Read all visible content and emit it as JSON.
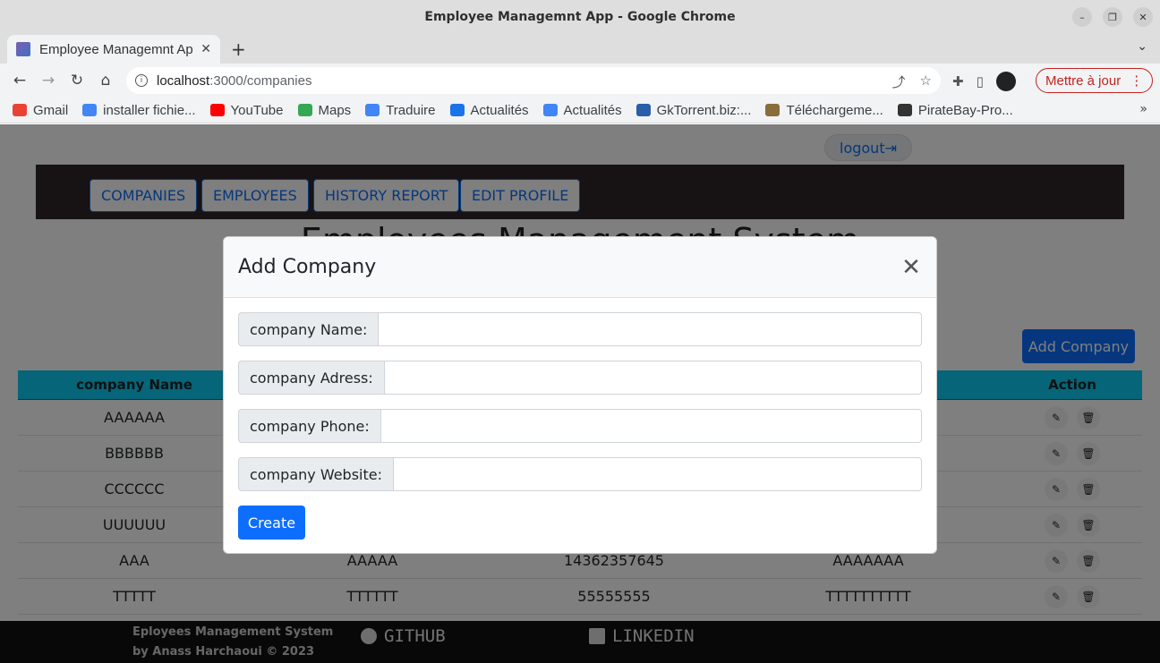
{
  "window": {
    "title": "Employee Managemnt App - Google Chrome"
  },
  "tab": {
    "title": "Employee Managemnt App",
    "close": "✕",
    "new_tab": "+",
    "menu": "⌄"
  },
  "toolbar": {
    "back": "←",
    "forward": "→",
    "reload": "↻",
    "home": "⌂",
    "url_host": "localhost",
    "url_rest": ":3000/companies",
    "share": "⤴",
    "star": "☆",
    "extensions": "✚",
    "sidepanel": "▯",
    "update_label": "Mettre à jour",
    "update_menu": "⋮"
  },
  "bookmarks": {
    "items": [
      {
        "label": "Gmail",
        "color": "#ea4335"
      },
      {
        "label": "installer fichie...",
        "color": "#4285f4"
      },
      {
        "label": "YouTube",
        "color": "#ff0000"
      },
      {
        "label": "Maps",
        "color": "#34a853"
      },
      {
        "label": "Traduire",
        "color": "#4285f4"
      },
      {
        "label": "Actualités",
        "color": "#1a73e8"
      },
      {
        "label": "Actualités",
        "color": "#4285f4"
      },
      {
        "label": "GkTorrent.biz:...",
        "color": "#2a5ea8"
      },
      {
        "label": "Téléchargeme...",
        "color": "#8a6d3b"
      },
      {
        "label": "PirateBay-Pro...",
        "color": "#333333"
      }
    ],
    "more": "»"
  },
  "page": {
    "logout_label": "logout",
    "logout_icon": "⇥",
    "nav": [
      "COMPANIES",
      "EMPLOYEES",
      "HISTORY REPORT",
      "EDIT PROFILE"
    ],
    "title": "Employees Management System",
    "add_company_label": "Add Company",
    "table": {
      "headers": [
        "company Name",
        "",
        "",
        "",
        "Action"
      ],
      "rows": [
        [
          "AAAAAA",
          "",
          "",
          ""
        ],
        [
          "BBBBBB",
          "",
          "",
          ""
        ],
        [
          "CCCCCC",
          "",
          "",
          ""
        ],
        [
          "UUUUUU",
          "",
          "",
          ""
        ],
        [
          "AAA",
          "AAAAA",
          "14362357645",
          "AAAAAAA"
        ],
        [
          "TTTTT",
          "TTTTTT",
          "55555555",
          "TTTTTTTTTT"
        ]
      ],
      "edit_icon": "✎",
      "delete_icon": "🗑"
    },
    "footer": {
      "credit_line1": "Eployees Management System",
      "credit_line2": "by Anass Harchaoui © 2023",
      "github": "GITHUB",
      "linkedin": "LINKEDIN"
    }
  },
  "modal": {
    "title": "Add Company",
    "close": "✕",
    "fields": [
      {
        "label": "company Name:",
        "value": ""
      },
      {
        "label": "company Adress:",
        "value": ""
      },
      {
        "label": "company Phone:",
        "value": ""
      },
      {
        "label": "company Website:",
        "value": ""
      }
    ],
    "create_label": "Create"
  }
}
